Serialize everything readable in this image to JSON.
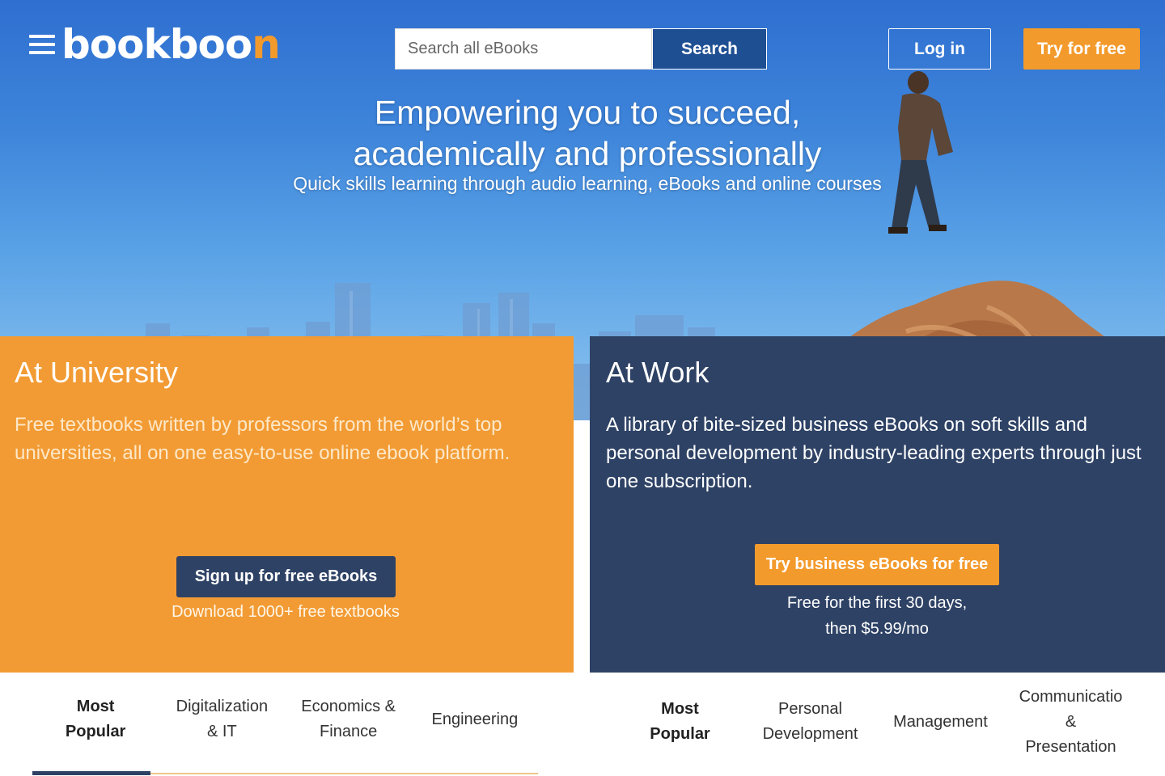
{
  "header": {
    "logo_main": "bookboo",
    "logo_accent": "n",
    "search": {
      "placeholder": "Search all eBooks",
      "button_label": "Search"
    },
    "login_label": "Log in",
    "try_label": "Try for free"
  },
  "hero": {
    "headline_line1": "Empowering you to succeed,",
    "headline_line2": "academically and professionally",
    "subline": "Quick skills learning through audio learning, eBooks and online courses"
  },
  "university": {
    "title": "At University",
    "description": "Free textbooks written by professors from the world’s top universities, all on one easy-to-use online ebook platform.",
    "cta_label": "Sign up for free eBooks",
    "cta_note": "Download 1000+ free textbooks"
  },
  "work": {
    "title": "At Work",
    "description": "A library of bite-sized business eBooks on soft skills and personal development by industry-leading experts through just one subscription.",
    "cta_label": "Try business eBooks for free",
    "cta_note_line1": "Free for the first 30 days,",
    "cta_note_line2": "then $5.99/mo"
  },
  "university_tabs": [
    {
      "line1": "Most",
      "line2": "Popular"
    },
    {
      "line1": "Digitalization",
      "line2": "& IT"
    },
    {
      "line1": "Economics &",
      "line2": "Finance"
    },
    {
      "line1": "Engineering",
      "line2": ""
    }
  ],
  "work_tabs": [
    {
      "line1": "Most",
      "line2": "Popular",
      "line3": ""
    },
    {
      "line1": "Personal",
      "line2": "Development",
      "line3": ""
    },
    {
      "line1": "Management",
      "line2": "",
      "line3": ""
    },
    {
      "line1": "Communicatio",
      "line2": "&",
      "line3": "Presentation"
    }
  ],
  "colors": {
    "orange": "#f29b34",
    "navy": "#2e4265",
    "sky": "#3d84da"
  },
  "icons": {
    "menu": "hamburger-menu-icon"
  }
}
